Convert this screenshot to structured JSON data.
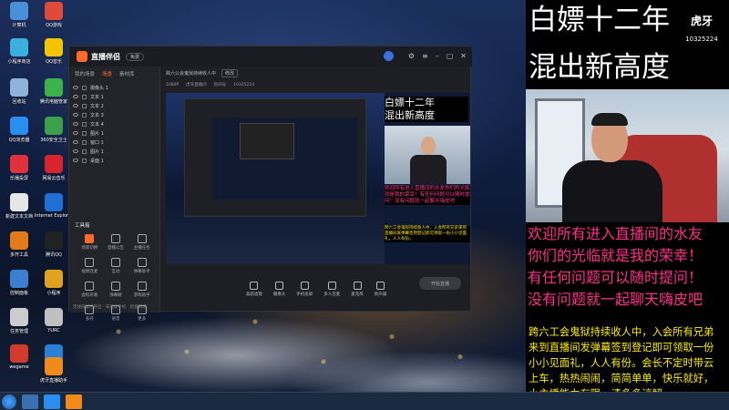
{
  "desktop": {
    "icons": [
      {
        "label": "计算机",
        "icon": "computer-icon",
        "color": "#4a90d9"
      },
      {
        "label": "QQ游戏",
        "icon": "qq-games-icon",
        "color": "#e04a3a"
      },
      {
        "label": "小程序商店",
        "icon": "store-icon",
        "color": "#3ab0e0"
      },
      {
        "label": "QQ音乐",
        "icon": "qq-music-icon",
        "color": "#f5c400"
      },
      {
        "label": "回收站",
        "icon": "recycle-bin-icon",
        "color": "#8fb3d9"
      },
      {
        "label": "腾讯电脑管家",
        "icon": "pc-manager-icon",
        "color": "#3cb34a"
      },
      {
        "label": "QQ浏览器",
        "icon": "qq-browser-icon",
        "color": "#2a8ef0"
      },
      {
        "label": "360安全卫士",
        "icon": "security-icon",
        "color": "#3aa04a"
      },
      {
        "label": "乐播投屏",
        "icon": "cast-icon",
        "color": "#e0323a"
      },
      {
        "label": "网易云音乐",
        "icon": "netease-music-icon",
        "color": "#d9232d"
      },
      {
        "label": "新建文本文档",
        "icon": "text-doc-icon",
        "color": "#e6e6e6"
      },
      {
        "label": "Internet Explorer",
        "icon": "ie-icon",
        "color": "#1f6fd6"
      },
      {
        "label": "多开工具",
        "icon": "tool-icon",
        "color": "#e07a1a"
      },
      {
        "label": "腾讯QQ",
        "icon": "qq-icon",
        "color": "#222222"
      },
      {
        "label": "控制面板",
        "icon": "control-panel-icon",
        "color": "#3a7fd0"
      },
      {
        "label": "小程序",
        "icon": "miniapp-icon",
        "color": "#e0a020"
      },
      {
        "label": "任务管理",
        "icon": "task-icon",
        "color": "#cccccc"
      },
      {
        "label": "YURC",
        "icon": "yurc-icon",
        "color": "#c0c0c0"
      },
      {
        "label": "wegame",
        "icon": "wegame-icon",
        "color": "#d23a2a"
      },
      {
        "label": "网易",
        "icon": "netease-icon",
        "color": "#2a7fd6"
      },
      {
        "label": "虎牙直播助手",
        "icon": "live-assistant-icon",
        "color": "#f08a1a"
      }
    ]
  },
  "app": {
    "name": "直播伴侣",
    "badge": "免费",
    "sidebar_tabs": [
      "我的场景",
      "场景",
      "素材库"
    ],
    "scenes": [
      "摄像头 1",
      "文本 1",
      "文本 2",
      "文本 3",
      "文本 4",
      "图片 1",
      "窗口 1",
      "图片 1",
      "桌面 1"
    ],
    "tools_title": "工具箱",
    "tools": [
      "场景切换",
      "直播公告",
      "主播任务",
      "视频连麦",
      "互动",
      "弹幕助手",
      "虚拟形象",
      "弹幕姬",
      "游戏助手",
      "多开",
      "语音",
      "更多"
    ],
    "status_text": "无线投屏已开启 · 未连接手机 · 检查网络",
    "top_bar": {
      "title": "跨六公会鬼狱持续收人中",
      "tag": "修改"
    },
    "sub_bar": [
      "1080P",
      "虎牙直播间",
      "房间号",
      "10325224"
    ],
    "bottom_tools": [
      "美颜滤镜",
      "摄像头",
      "手机投屏",
      "多人连麦",
      "麦克风",
      "扬声器"
    ],
    "go_live": "开始直播"
  },
  "preview": {
    "title_l1": "白嫖十二年",
    "title_l2": "混出新高度",
    "red_text": "欢迎所有进入直播间的水友你们的光临就是我的荣幸！有任何问题可以随时提问！没有问题就一起聊天嗨皮吧",
    "yellow_text": "跨六工会鬼狱持续收人中，入会所有兄弟来到直播间发弹幕签到登记即可领取一份小小见面礼，人人有份。"
  },
  "overlay": {
    "title_l1": "白嫖十二年",
    "title_l2": "混出新高度",
    "brand": "虎牙",
    "room_number": "10325224",
    "red_lines": [
      "欢迎所有进入直播间的水友",
      "你们的光临就是我的荣幸！",
      "有任何问题可以随时提问！",
      "没有问题就一起聊天嗨皮吧"
    ],
    "yellow_lines": [
      "跨六工会鬼狱持续收人中，入会所有兄弟",
      "来到直播间发弹幕签到登记即可领取一份",
      "小小见面礼，人人有份。会长不定时带云",
      "上车，热热闹闹，简简单单，快乐就好，",
      "小主播能力有限，请多多谅解。"
    ],
    "colors": {
      "red": "#ff2f8a",
      "yellow": "#ffee00",
      "title": "#ffffff"
    }
  }
}
